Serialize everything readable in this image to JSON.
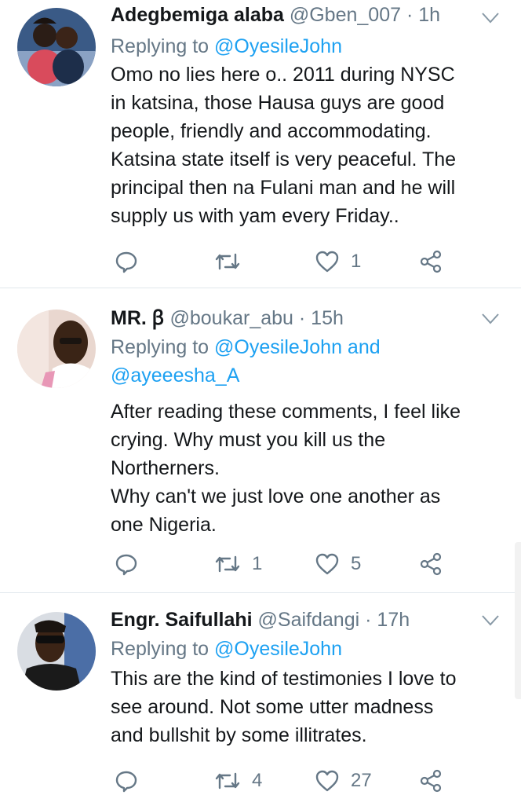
{
  "tweets": [
    {
      "name": "Adegbemiga alaba",
      "handle": "@Gben_007",
      "dot": "·",
      "time": "1h",
      "reply_prefix": "Replying to",
      "reply_mentions_line1": "@OyesileJohn",
      "reply_mentions_line2": "",
      "body_lines": [
        "Omo no lies here o.. 2011 during NYSC",
        "in katsina, those Hausa guys are good",
        "people, friendly and accommodating.",
        "Katsina state itself is very peaceful. The",
        "principal then na Fulani man and he will",
        "supply us with yam every Friday.."
      ],
      "reply_count": "",
      "retweet_count": "",
      "like_count": "1"
    },
    {
      "name": "MR. ꞵ",
      "handle": "@boukar_abu",
      "dot": "·",
      "time": "15h",
      "reply_prefix": "Replying to",
      "reply_mentions_line1": "@OyesileJohn and",
      "reply_mentions_line2": "@ayeeesha_A",
      "body_lines": [
        "After reading these comments, I feel like",
        "crying. Why must you kill us the",
        "Northerners.",
        "Why can't we just love one another as",
        "one Nigeria."
      ],
      "reply_count": "",
      "retweet_count": "1",
      "like_count": "5"
    },
    {
      "name": "Engr. Saifullahi",
      "handle": "@Saifdangi",
      "dot": "·",
      "time": "17h",
      "reply_prefix": "Replying to",
      "reply_mentions_line1": "@OyesileJohn",
      "reply_mentions_line2": "",
      "body_lines": [
        "This are the kind of testimonies I love to",
        "see around. Not some utter madness",
        "and bullshit by some illitrates."
      ],
      "reply_count": "",
      "retweet_count": "4",
      "like_count": "27"
    }
  ],
  "icons": {
    "reply": "reply-icon",
    "retweet": "retweet-icon",
    "like": "heart-icon",
    "share": "share-icon",
    "more": "chevron-down-icon"
  },
  "colors": {
    "link": "#1da1f2",
    "secondary": "#657786",
    "text": "#14171a",
    "divider": "#e1e8ed"
  }
}
